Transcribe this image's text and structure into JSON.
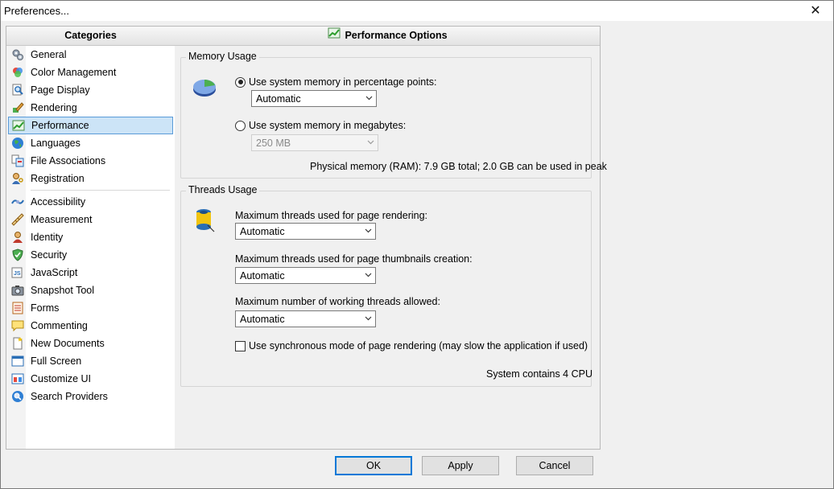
{
  "window": {
    "title": "Preferences...",
    "close_glyph": "✕"
  },
  "categories": {
    "header": "Categories",
    "group1": [
      {
        "label": "General",
        "icon": "gears-icon"
      },
      {
        "label": "Color Management",
        "icon": "color-circles-icon"
      },
      {
        "label": "Page Display",
        "icon": "magnifier-page-icon"
      },
      {
        "label": "Rendering",
        "icon": "brush-icon"
      },
      {
        "label": "Performance",
        "icon": "chart-icon",
        "selected": true
      },
      {
        "label": "Languages",
        "icon": "globe-icon"
      },
      {
        "label": "File Associations",
        "icon": "file-assoc-icon"
      },
      {
        "label": "Registration",
        "icon": "key-user-icon"
      }
    ],
    "group2": [
      {
        "label": "Accessibility",
        "icon": "accessibility-icon"
      },
      {
        "label": "Measurement",
        "icon": "ruler-icon"
      },
      {
        "label": "Identity",
        "icon": "identity-icon"
      },
      {
        "label": "Security",
        "icon": "shield-icon"
      },
      {
        "label": "JavaScript",
        "icon": "javascript-icon"
      },
      {
        "label": "Snapshot Tool",
        "icon": "camera-icon"
      },
      {
        "label": "Forms",
        "icon": "forms-icon"
      },
      {
        "label": "Commenting",
        "icon": "comment-icon"
      },
      {
        "label": "New Documents",
        "icon": "new-document-icon"
      },
      {
        "label": "Full Screen",
        "icon": "fullscreen-icon"
      },
      {
        "label": "Customize UI",
        "icon": "customize-icon"
      },
      {
        "label": "Search Providers",
        "icon": "search-globe-icon"
      }
    ]
  },
  "options": {
    "header": "Performance Options",
    "memory": {
      "title": "Memory Usage",
      "percent_label": "Use system memory in percentage points:",
      "percent_value": "Automatic",
      "mb_label": "Use system memory in megabytes:",
      "mb_value": "250 MB",
      "info": "Physical memory (RAM): 7.9 GB total; 2.0 GB can be used in peak"
    },
    "threads": {
      "title": "Threads Usage",
      "render_label": "Maximum threads used for page rendering:",
      "render_value": "Automatic",
      "thumb_label": "Maximum threads used for page thumbnails creation:",
      "thumb_value": "Automatic",
      "working_label": "Maximum number of working threads allowed:",
      "working_value": "Automatic",
      "sync_label": "Use synchronous mode of page rendering (may slow the application if used)",
      "cpu_info": "System contains 4 CPU"
    }
  },
  "buttons": {
    "ok": "OK",
    "apply": "Apply",
    "cancel": "Cancel"
  },
  "colors": {
    "selection_bg": "#cce4f7",
    "selection_border": "#5a9bd8",
    "default_button_border": "#0078d7"
  }
}
